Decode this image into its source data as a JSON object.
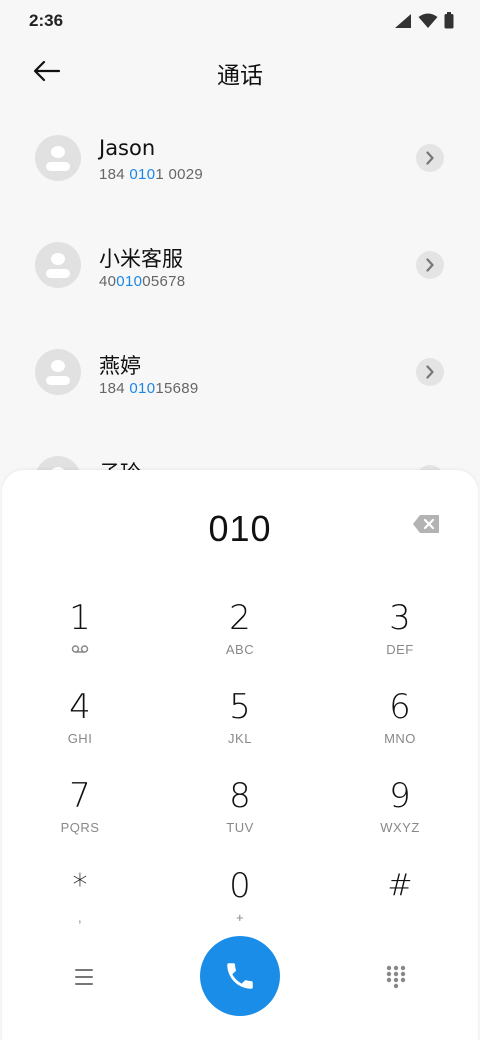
{
  "status_bar": {
    "time": "2:36"
  },
  "header": {
    "title": "通话"
  },
  "contacts": [
    {
      "name": "Jason",
      "number_pre": "184 ",
      "number_hl": "010",
      "number_post": "1 0029"
    },
    {
      "name": "小米客服",
      "number_pre": "40",
      "number_hl": "010",
      "number_post": "05678"
    },
    {
      "name": "燕婷",
      "number_pre": "184 ",
      "number_hl": "010",
      "number_post": "15689"
    },
    {
      "name": "子玲",
      "number_pre": "",
      "number_hl": "",
      "number_post": ""
    }
  ],
  "dialpad": {
    "input": "010",
    "keys": [
      {
        "digit": "1",
        "letters": ""
      },
      {
        "digit": "2",
        "letters": "ABC"
      },
      {
        "digit": "3",
        "letters": "DEF"
      },
      {
        "digit": "4",
        "letters": "GHI"
      },
      {
        "digit": "5",
        "letters": "JKL"
      },
      {
        "digit": "6",
        "letters": "MNO"
      },
      {
        "digit": "7",
        "letters": "PQRS"
      },
      {
        "digit": "8",
        "letters": "TUV"
      },
      {
        "digit": "9",
        "letters": "WXYZ"
      },
      {
        "digit": "*",
        "letters": ","
      },
      {
        "digit": "0",
        "letters": "+"
      },
      {
        "digit": "#",
        "letters": ""
      }
    ]
  },
  "icons": {
    "back": "arrow-left-icon",
    "detail": "chevron-right-icon",
    "backspace": "backspace-icon",
    "voicemail": "voicemail-icon",
    "menu": "menu-icon",
    "call": "phone-icon",
    "keypad": "dialpad-icon"
  },
  "colors": {
    "accent": "#1a8de9",
    "highlight": "#1a87e8"
  }
}
